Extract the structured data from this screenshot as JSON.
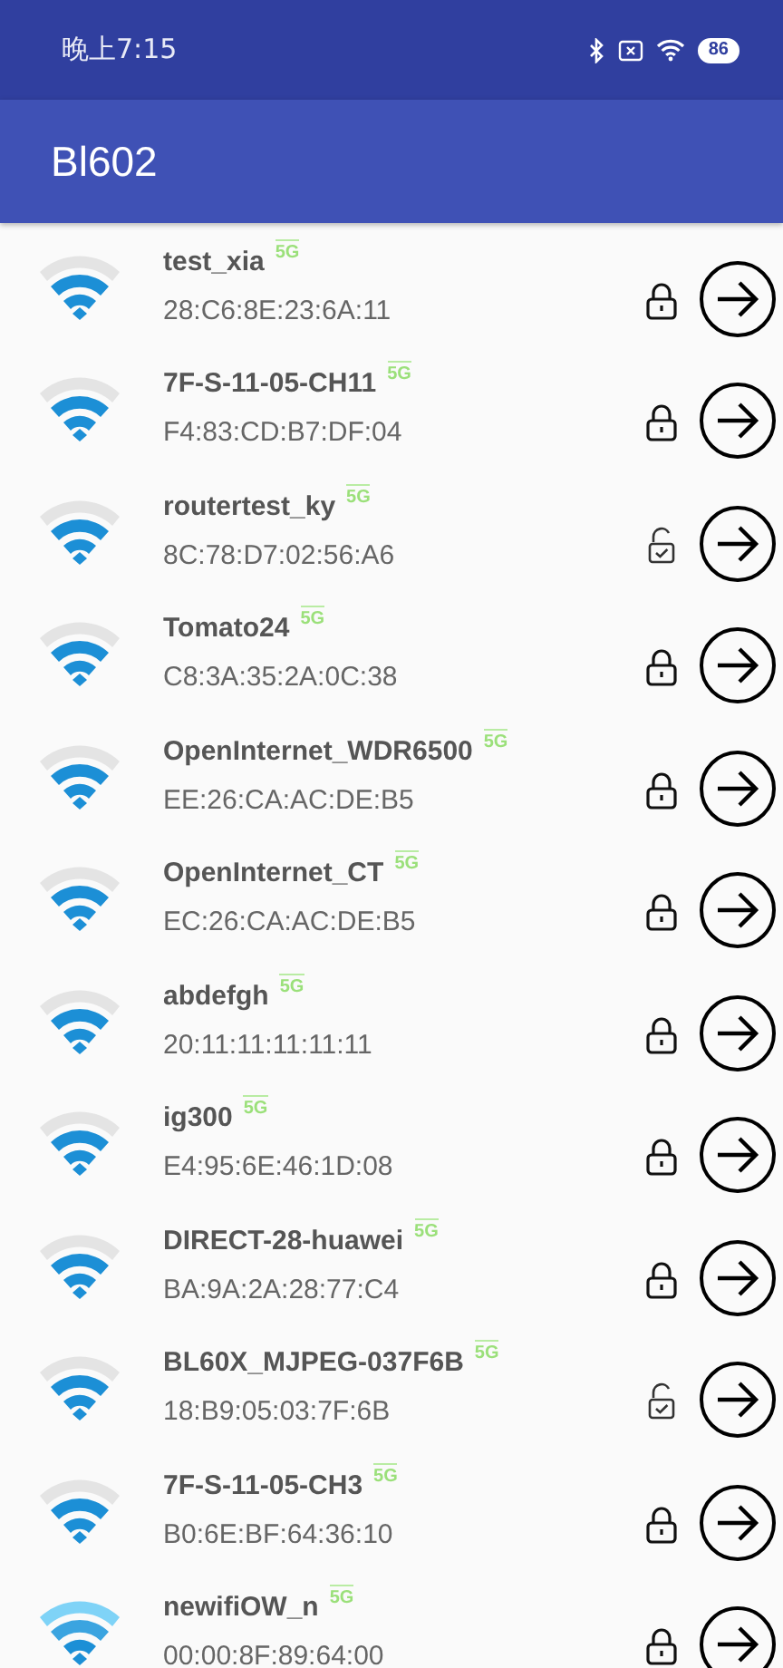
{
  "status_bar": {
    "time": "晚上7:15",
    "battery": "86"
  },
  "app_bar": {
    "title": "Bl602"
  },
  "networks": [
    {
      "ssid": "test_xia",
      "band": "5G",
      "mac": "28:C6:8E:23:6A:11",
      "kind": "three_bars",
      "secured": true
    },
    {
      "ssid": "7F-S-11-05-CH11",
      "band": "5G",
      "mac": "F4:83:CD:B7:DF:04",
      "kind": "three_bars",
      "secured": true
    },
    {
      "ssid": "routertest_ky",
      "band": "5G",
      "mac": "8C:78:D7:02:56:A6",
      "kind": "three_bars",
      "secured": false
    },
    {
      "ssid": "Tomato24",
      "band": "5G",
      "mac": "C8:3A:35:2A:0C:38",
      "kind": "three_bars",
      "secured": true
    },
    {
      "ssid": "OpenInternet_WDR6500",
      "band": "5G",
      "mac": "EE:26:CA:AC:DE:B5",
      "kind": "three_bars",
      "secured": true
    },
    {
      "ssid": "OpenInternet_CT",
      "band": "5G",
      "mac": "EC:26:CA:AC:DE:B5",
      "kind": "three_bars",
      "secured": true
    },
    {
      "ssid": "abdefgh",
      "band": "5G",
      "mac": "20:11:11:11:11:11",
      "kind": "three_bars",
      "secured": true
    },
    {
      "ssid": "ig300",
      "band": "5G",
      "mac": "E4:95:6E:46:1D:08",
      "kind": "three_bars",
      "secured": true
    },
    {
      "ssid": "DIRECT-28-huawei",
      "band": "5G",
      "mac": "BA:9A:2A:28:77:C4",
      "kind": "three_bars",
      "secured": true
    },
    {
      "ssid": "BL60X_MJPEG-037F6B",
      "band": "5G",
      "mac": "18:B9:05:03:7F:6B",
      "kind": "three_bars",
      "secured": false
    },
    {
      "ssid": "7F-S-11-05-CH3",
      "band": "5G",
      "mac": "B0:6E:BF:64:36:10",
      "kind": "three_bars",
      "secured": true
    },
    {
      "ssid": "newifiOW_n",
      "band": "5G",
      "mac": "00:00:8F:89:64:00",
      "kind": "full",
      "secured": true
    }
  ]
}
